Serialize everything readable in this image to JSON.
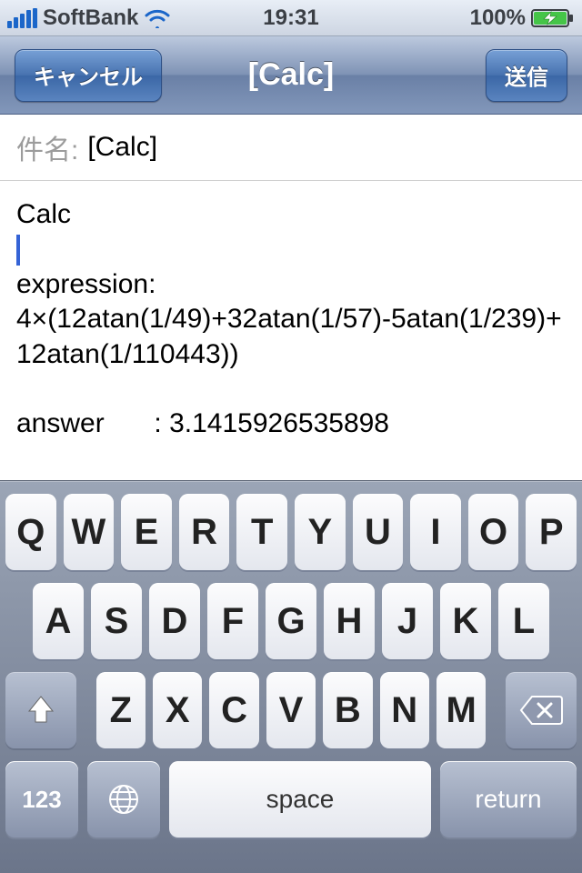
{
  "status": {
    "carrier": "SoftBank",
    "time": "19:31",
    "battery_pct": "100%"
  },
  "nav": {
    "cancel_label": "キャンセル",
    "title": "[Calc]",
    "send_label": "送信"
  },
  "compose": {
    "subject_label": "件名:",
    "subject_value": "[Calc]",
    "body": {
      "line1": "Calc",
      "line2_label": "expression:",
      "line2_value": "4×(12atan(1/49)+32atan(1/57)-5atan(1/239)+12atan(1/110443))",
      "answer_label": "answer",
      "answer_value": ": 3.1415926535898"
    }
  },
  "keyboard": {
    "row1": [
      "Q",
      "W",
      "E",
      "R",
      "T",
      "Y",
      "U",
      "I",
      "O",
      "P"
    ],
    "row2": [
      "A",
      "S",
      "D",
      "F",
      "G",
      "H",
      "J",
      "K",
      "L"
    ],
    "row3": [
      "Z",
      "X",
      "C",
      "V",
      "B",
      "N",
      "M"
    ],
    "numbers_key": "123",
    "space_key": "space",
    "return_key": "return"
  }
}
